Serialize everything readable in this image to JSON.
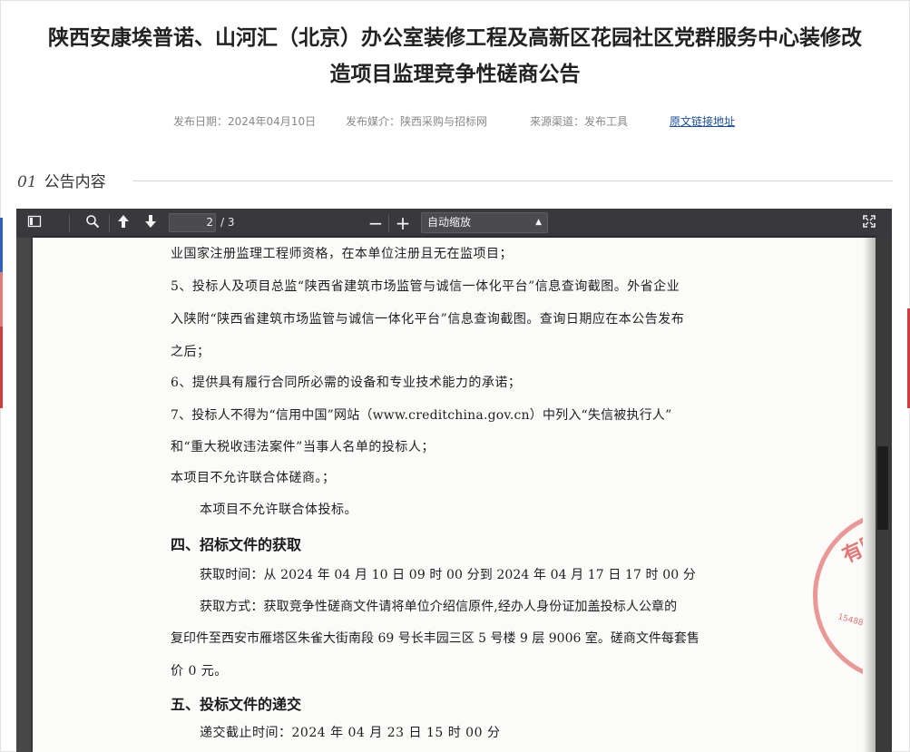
{
  "article": {
    "title_line1": "陕西安康埃普诺、山河汇（北京）办公室装修工程及高新区花园社区党群服务中心装修改",
    "title_line2": "造项目监理竞争性磋商公告",
    "meta": {
      "date": "发布日期：2024年04月10日",
      "media": "发布媒介：陕西采购与招标网",
      "channel": "来源渠道：发布工具",
      "link": "原文链接地址"
    },
    "section_num": "01",
    "section_title": "公告内容"
  },
  "viewer": {
    "page_current": "2",
    "page_total": "/ 3",
    "zoom": "自动缩放",
    "icons": {
      "sidebar": "sidebar-toggle-icon",
      "search": "search-icon",
      "prev": "arrow-up-icon",
      "next": "arrow-down-icon",
      "zoom_out": "minus-icon",
      "zoom_in": "plus-icon",
      "fullscreen": "fullscreen-icon"
    }
  },
  "document": {
    "lines": [
      "业国家注册监理工程师资格，在本单位注册且无在监项目；",
      "5、投标人及项目总监“陕西省建筑市场监管与诚信一体化平台”信息查询截图。外省企业",
      "入陕附“陕西省建筑市场监管与诚信一体化平台”信息查询截图。查询日期应在本公告发布",
      "之后；",
      "6、提供具有履行合同所必需的设备和专业技术能力的承诺；",
      "7、投标人不得为“信用中国”网站（www.creditchina.gov.cn）中列入“失信被执行人”",
      "和“重大税收违法案件”当事人名单的投标人；",
      "本项目不允许联合体磋商。；",
      "本项目不允许联合体投标。"
    ],
    "heading4": "四、招标文件的获取",
    "get_time": "获取时间：从 2024 年 04 月 10 日  09 时 00 分到 2024 年 04 月 17 日  17 时 00 分",
    "get_method_1": "获取方式：获取竞争性磋商文件请将单位介绍信原件,经办人身份证加盖投标人公章的",
    "get_method_2": "复印件至西安市雁塔区朱雀大街南段 69 号长丰园三区 5 号楼 9 层 9006 室。磋商文件每套售",
    "get_method_3": "价  0  元。",
    "heading5": "五、投标文件的递交",
    "deadline": "递交截止时间：2024 年 04 月 23 日  15 时 00 分",
    "stamp_text": "有限",
    "stamp_num": "15488"
  },
  "colors": {
    "link": "#1a4fa0",
    "toolbar": "#38383d",
    "stamp": "#dc4646"
  }
}
